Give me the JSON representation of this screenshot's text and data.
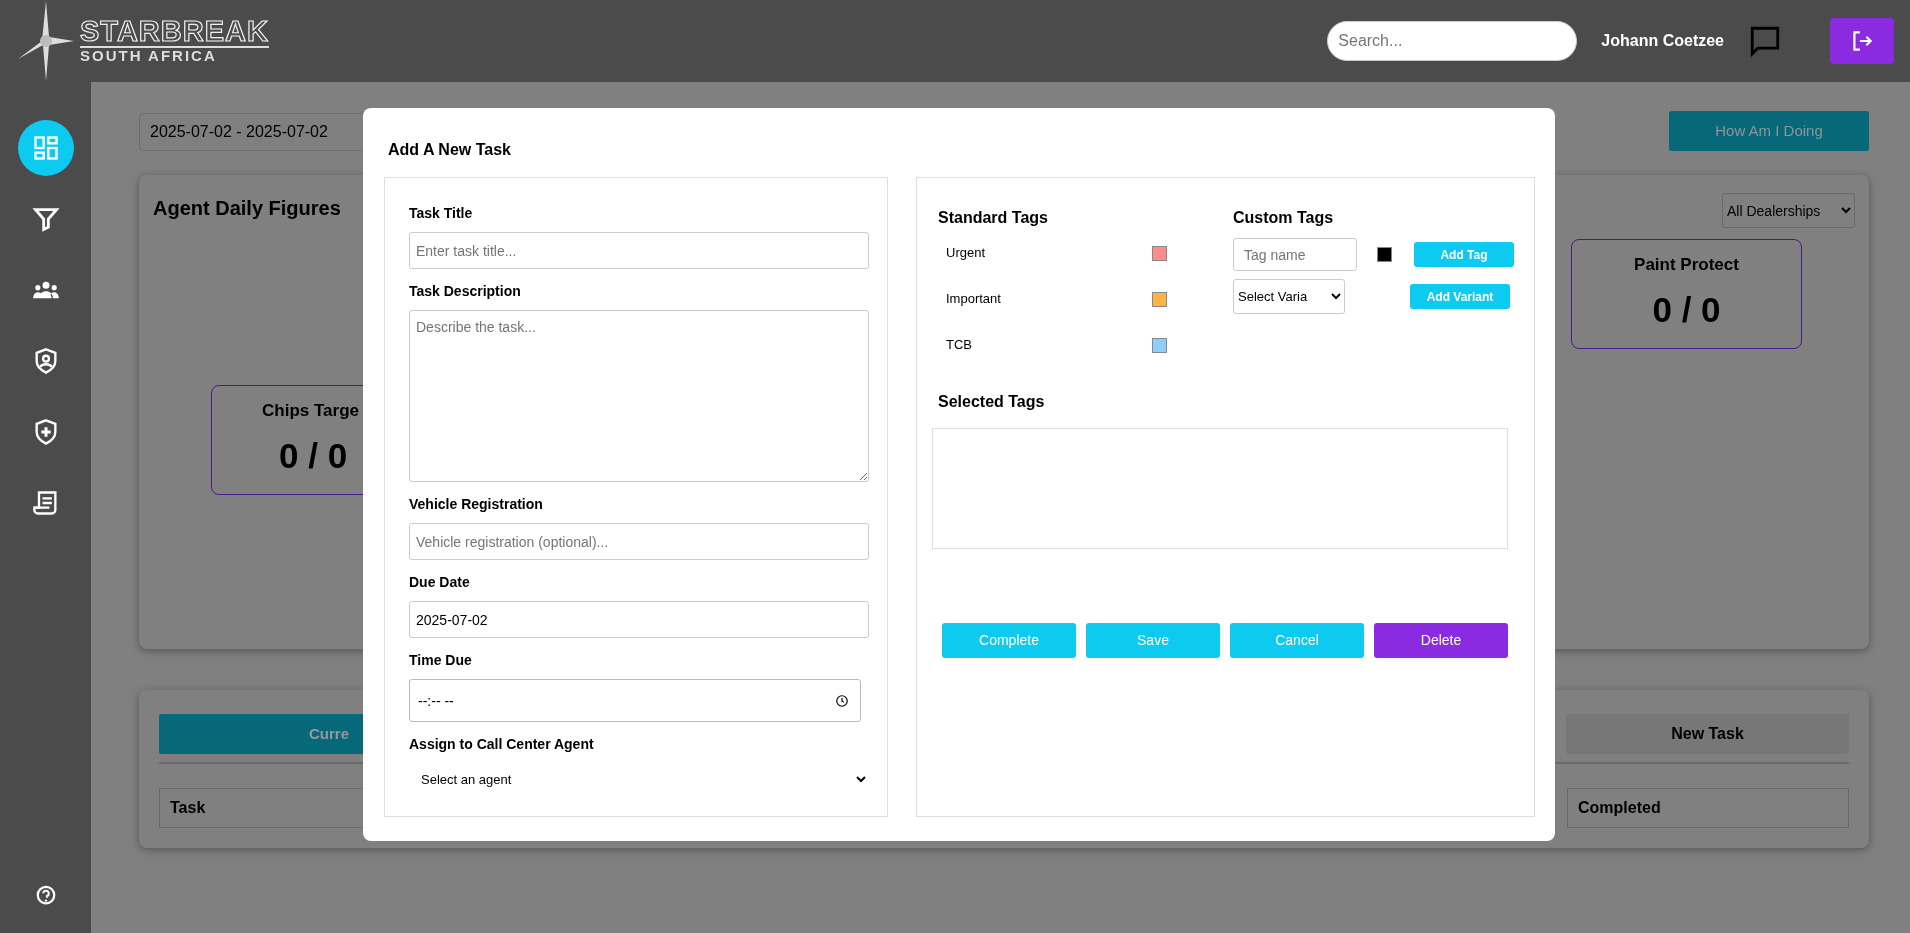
{
  "header": {
    "logo": {
      "title": "STARBREAK",
      "subtitle": "SOUTH AFRICA"
    },
    "search": {
      "placeholder": "Search..."
    },
    "user_name": "Johann Coetzee"
  },
  "sidebar": {
    "items": [
      {
        "selected": true
      },
      {
        "selected": false
      },
      {
        "selected": false
      },
      {
        "selected": false
      },
      {
        "selected": false
      },
      {
        "selected": false
      }
    ]
  },
  "filters": {
    "date_range": "2025-07-02 - 2025-07-02",
    "report_button": "How Am I Doing",
    "dealership_select": "All Dealerships"
  },
  "daily_figures": {
    "title": "Agent Daily Figures",
    "stats": [
      {
        "label": "Paint Protect",
        "value": "0 / 0"
      },
      {
        "label": "Chips Targe",
        "value": "0 / 0"
      }
    ]
  },
  "tasks_card": {
    "tabs": [
      {
        "label": "Curre",
        "selected": true
      },
      {
        "label": "New Task",
        "selected": false
      }
    ],
    "columns": [
      "Task",
      "Completed"
    ]
  },
  "modal": {
    "title": "Add A New Task",
    "fields": [
      {
        "label": "Task Title",
        "kind": "text",
        "placeholder": "Enter task title..."
      },
      {
        "label": "Task Description",
        "kind": "textarea",
        "placeholder": "Describe the task..."
      },
      {
        "label": "Vehicle Registration",
        "kind": "text",
        "placeholder": "Vehicle registration (optional)..."
      },
      {
        "label": "Due Date",
        "kind": "text",
        "value": "2025-07-02"
      },
      {
        "label": "Time Due",
        "kind": "time",
        "value": "--:-- --"
      },
      {
        "label": "Assign to Call Center Agent",
        "kind": "select",
        "value": "Select an agent"
      }
    ],
    "standard_tags": {
      "title": "Standard Tags",
      "tags": [
        {
          "label": "Urgent",
          "color": "#ff8c8c"
        },
        {
          "label": "Important",
          "color": "#ffb347"
        },
        {
          "label": "TCB",
          "color": "#8fcdfa"
        }
      ]
    },
    "custom_tags": {
      "title": "Custom Tags",
      "tag_name_placeholder": "Tag name",
      "color": "#000000",
      "add_tag_button": "Add Tag",
      "variant_select": "Select Varia",
      "add_variant_button": "Add Variant"
    },
    "selected_tags": {
      "title": "Selected Tags"
    },
    "actions": [
      {
        "label": "Complete",
        "kind": "primary"
      },
      {
        "label": "Save",
        "kind": "primary"
      },
      {
        "label": "Cancel",
        "kind": "primary"
      },
      {
        "label": "Delete",
        "kind": "danger"
      }
    ]
  }
}
